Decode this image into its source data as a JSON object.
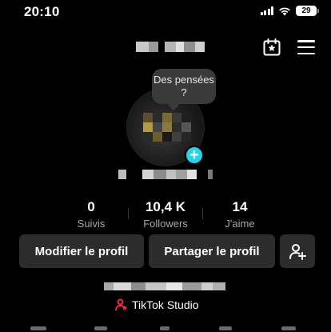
{
  "status_bar": {
    "time": "20:10",
    "battery": "29"
  },
  "profile": {
    "thought_bubble": "Des pensées ?",
    "add_badge": "+"
  },
  "stats": [
    {
      "value": "0",
      "label": "Suivis"
    },
    {
      "value": "10,4 K",
      "label": "Followers"
    },
    {
      "value": "14",
      "label": "J'aime"
    }
  ],
  "actions": {
    "edit_label": "Modifier le profil",
    "share_label": "Partager le profil"
  },
  "studio": {
    "label": "TikTok Studio"
  },
  "colors": {
    "accent_cyan": "#20d5ec",
    "studio_red": "#fe2c55",
    "button_bg": "#2c2c2c"
  }
}
